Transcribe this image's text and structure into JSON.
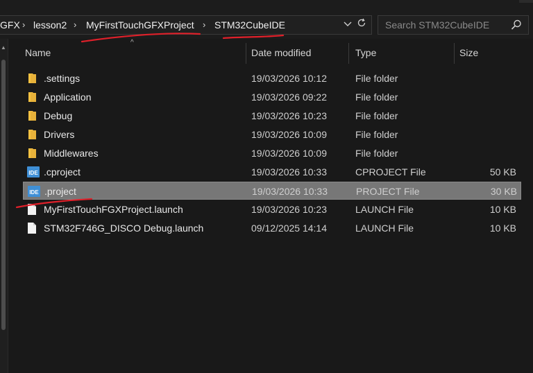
{
  "breadcrumb": {
    "items": [
      "GFX",
      "lesson2",
      "MyFirstTouchGFXProject",
      "STM32CubeIDE"
    ],
    "separator": "›"
  },
  "addressbar": {
    "dropdown_icon": "chevron-down-icon",
    "refresh_icon": "refresh-icon"
  },
  "search": {
    "placeholder": "Search STM32CubeIDE",
    "icon": "search-icon"
  },
  "columns": {
    "name": "Name",
    "date": "Date modified",
    "type": "Type",
    "size": "Size"
  },
  "files": [
    {
      "name": ".settings",
      "date": "19/03/2026 10:12",
      "type": "File folder",
      "size": "",
      "icon": "folder-icon"
    },
    {
      "name": "Application",
      "date": "19/03/2026 09:22",
      "type": "File folder",
      "size": "",
      "icon": "folder-icon"
    },
    {
      "name": "Debug",
      "date": "19/03/2026 10:23",
      "type": "File folder",
      "size": "",
      "icon": "folder-icon"
    },
    {
      "name": "Drivers",
      "date": "19/03/2026 10:09",
      "type": "File folder",
      "size": "",
      "icon": "folder-icon"
    },
    {
      "name": "Middlewares",
      "date": "19/03/2026 10:09",
      "type": "File folder",
      "size": "",
      "icon": "folder-icon"
    },
    {
      "name": ".cproject",
      "date": "19/03/2026 10:33",
      "type": "CPROJECT File",
      "size": "50 KB",
      "icon": "ide-file-icon"
    },
    {
      "name": ".project",
      "date": "19/03/2026 10:33",
      "type": "PROJECT File",
      "size": "30 KB",
      "icon": "ide-file-icon"
    },
    {
      "name": "MyFirstTouchFGXProject.launch",
      "date": "19/03/2026 10:23",
      "type": "LAUNCH File",
      "size": "10 KB",
      "icon": "document-icon"
    },
    {
      "name": "STM32F746G_DISCO Debug.launch",
      "date": "09/12/2025 14:14",
      "type": "LAUNCH File",
      "size": "10 KB",
      "icon": "document-icon"
    }
  ],
  "selected_row": 6,
  "colors": {
    "background": "#191919",
    "selection": "#777777",
    "folder": "#f5c242",
    "ide_badge": "#3f8fd6",
    "annotation": "#e0202a"
  }
}
